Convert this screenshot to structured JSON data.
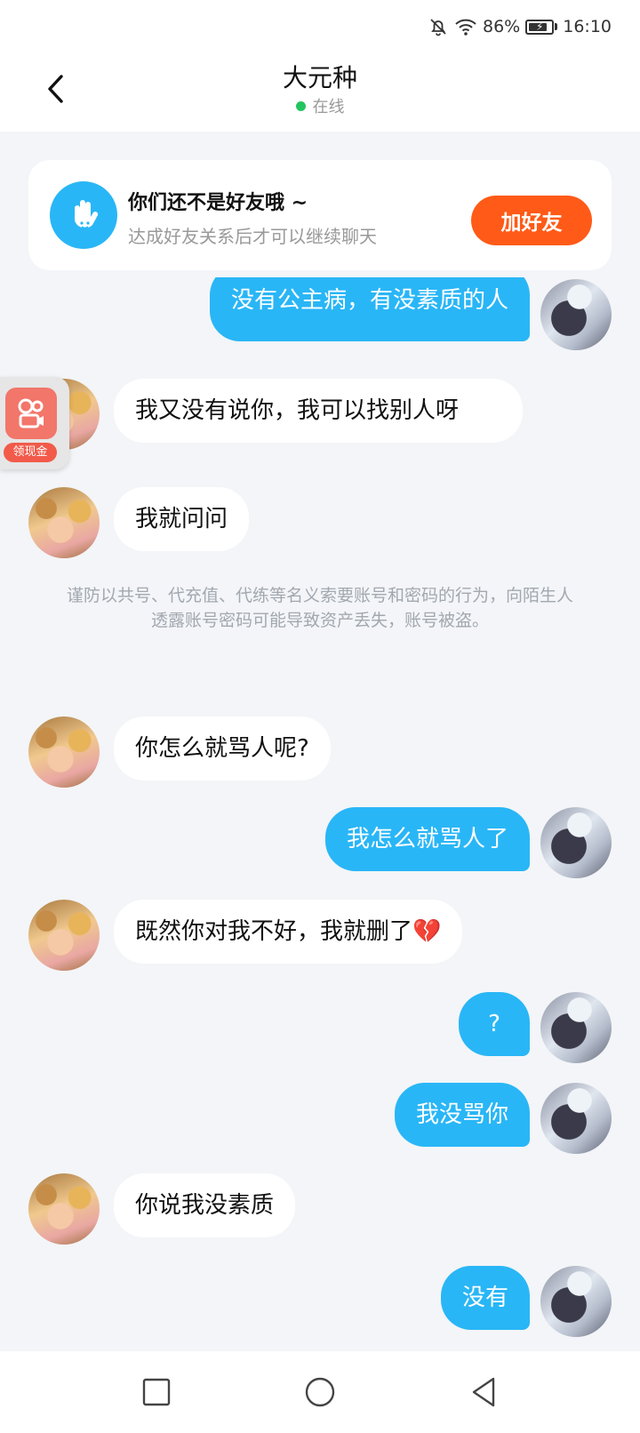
{
  "status_bar": {
    "battery": "86%",
    "time": "16:10"
  },
  "header": {
    "title": "大元种",
    "presence": "在线"
  },
  "friend_card": {
    "title": "你们还不是好友哦 ~",
    "subtitle": "达成好友关系后才可以继续聊天",
    "button": "加好友"
  },
  "messages": [
    {
      "sender": "me",
      "text": "没有公主病，有没素质的人"
    },
    {
      "sender": "other",
      "text": "我又没有说你，我可以找别人呀"
    },
    {
      "sender": "other",
      "text": "我就问问"
    },
    {
      "sender": "system",
      "text": "谨防以共号、代充值、代练等名义索要账号和密码的行为，向陌生人透露账号密码可能导致资产丢失，账号被盗。"
    },
    {
      "sender": "other",
      "text": "你怎么就骂人呢?"
    },
    {
      "sender": "me",
      "text": "我怎么就骂人了"
    },
    {
      "sender": "other",
      "text": "既然你对我不好，我就删了💔"
    },
    {
      "sender": "me",
      "text": "?"
    },
    {
      "sender": "me",
      "text": "我没骂你"
    },
    {
      "sender": "other",
      "text": "你说我没素质"
    },
    {
      "sender": "me",
      "text": "没有"
    }
  ],
  "float_widget": {
    "label": "领现金"
  },
  "icons": {
    "back": "chevron-left-icon",
    "status": [
      "bell-off-icon",
      "wifi-icon",
      "battery-icon"
    ],
    "friend_card": "waving-hand-icon",
    "nav": [
      "recents-square-icon",
      "home-circle-icon",
      "back-triangle-icon"
    ]
  },
  "colors": {
    "accent": "#29b6f6",
    "add_friend": "#ff5a17",
    "online": "#22c55e",
    "background": "#f3f5f8"
  }
}
